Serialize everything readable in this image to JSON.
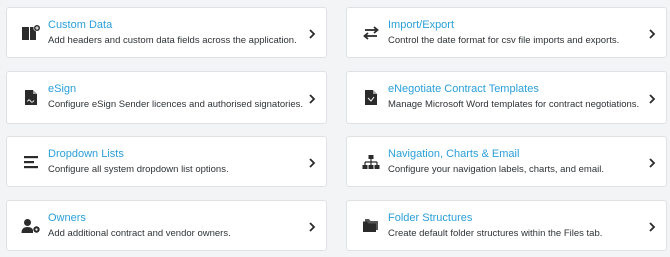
{
  "cards": [
    {
      "title": "Custom Data",
      "description": "Add headers and custom data fields across the application.",
      "icon": "custom-data-icon"
    },
    {
      "title": "Import/Export",
      "description": "Control the date format for csv file imports and exports.",
      "icon": "import-export-icon"
    },
    {
      "title": "eSign",
      "description": "Configure eSign Sender licences and authorised signatories.",
      "icon": "esign-icon"
    },
    {
      "title": "eNegotiate Contract Templates",
      "description": "Manage Microsoft Word templates for contract negotiations.",
      "icon": "document-icon"
    },
    {
      "title": "Dropdown Lists",
      "description": "Configure all system dropdown list options.",
      "icon": "list-icon"
    },
    {
      "title": "Navigation, Charts & Email",
      "description": "Configure your navigation labels, charts, and email.",
      "icon": "sitemap-icon"
    },
    {
      "title": "Owners",
      "description": "Add additional contract and vendor owners.",
      "icon": "user-gear-icon"
    },
    {
      "title": "Folder Structures",
      "description": "Create default folder structures within the Files tab.",
      "icon": "folder-icon"
    }
  ],
  "colors": {
    "title": "#2b9fd9",
    "text": "#2f3337",
    "icon": "#2b2b2b",
    "background": "#f3f4f5",
    "card": "#ffffff",
    "border": "#dfe1e4"
  }
}
